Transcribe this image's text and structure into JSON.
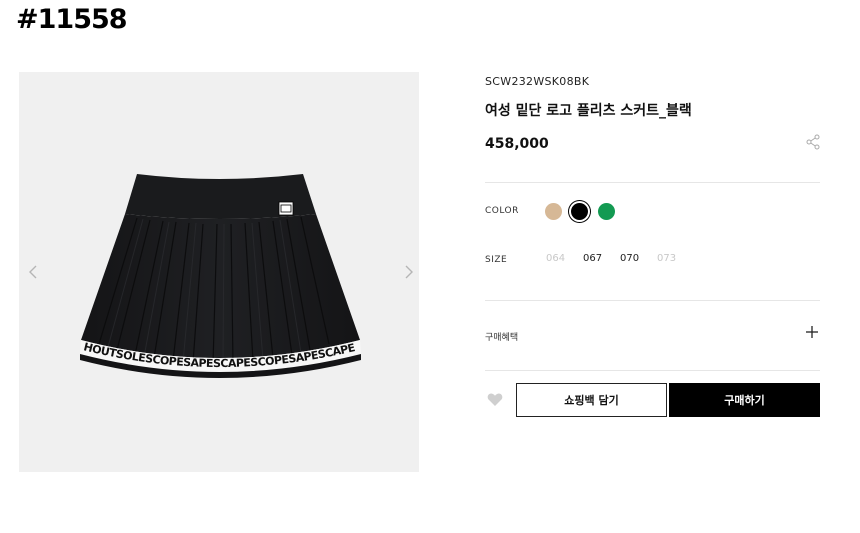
{
  "badge": "#11558",
  "gallery": {
    "skirt_band_text": "HOUTSOLESCOPESAPESCAPESCOPESAPESCAPESCAPESAFRICAHC",
    "patch_text": "SCO",
    "prev_icon": "chevron-left-icon",
    "next_icon": "chevron-right-icon"
  },
  "product": {
    "code": "SCW232WSK08BK",
    "title": "여성 밑단 로고 플리츠 스커트_블랙",
    "price": "458,000"
  },
  "options": {
    "color_label": "COLOR",
    "colors": [
      {
        "name": "beige",
        "hex": "#d6b896",
        "selected": false
      },
      {
        "name": "black",
        "hex": "#000000",
        "selected": true
      },
      {
        "name": "green",
        "hex": "#139a52",
        "selected": false
      }
    ],
    "size_label": "SIZE",
    "sizes": [
      {
        "label": "064",
        "available": false
      },
      {
        "label": "067",
        "available": true
      },
      {
        "label": "070",
        "available": true
      },
      {
        "label": "073",
        "available": false
      }
    ]
  },
  "benefits": {
    "label": "구매혜택"
  },
  "actions": {
    "cart_label": "쇼핑백 담기",
    "buy_label": "구매하기"
  }
}
